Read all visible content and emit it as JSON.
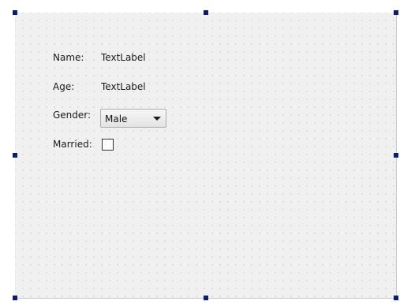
{
  "form": {
    "name_label": "Name:",
    "name_value": "TextLabel",
    "age_label": "Age:",
    "age_value": "TextLabel",
    "gender_label": "Gender:",
    "gender_selected": "Male",
    "married_label": "Married:",
    "married_checked": false
  },
  "colors": {
    "selection_handle": "#0b1d70",
    "grid_background": "#f0f0f0"
  }
}
